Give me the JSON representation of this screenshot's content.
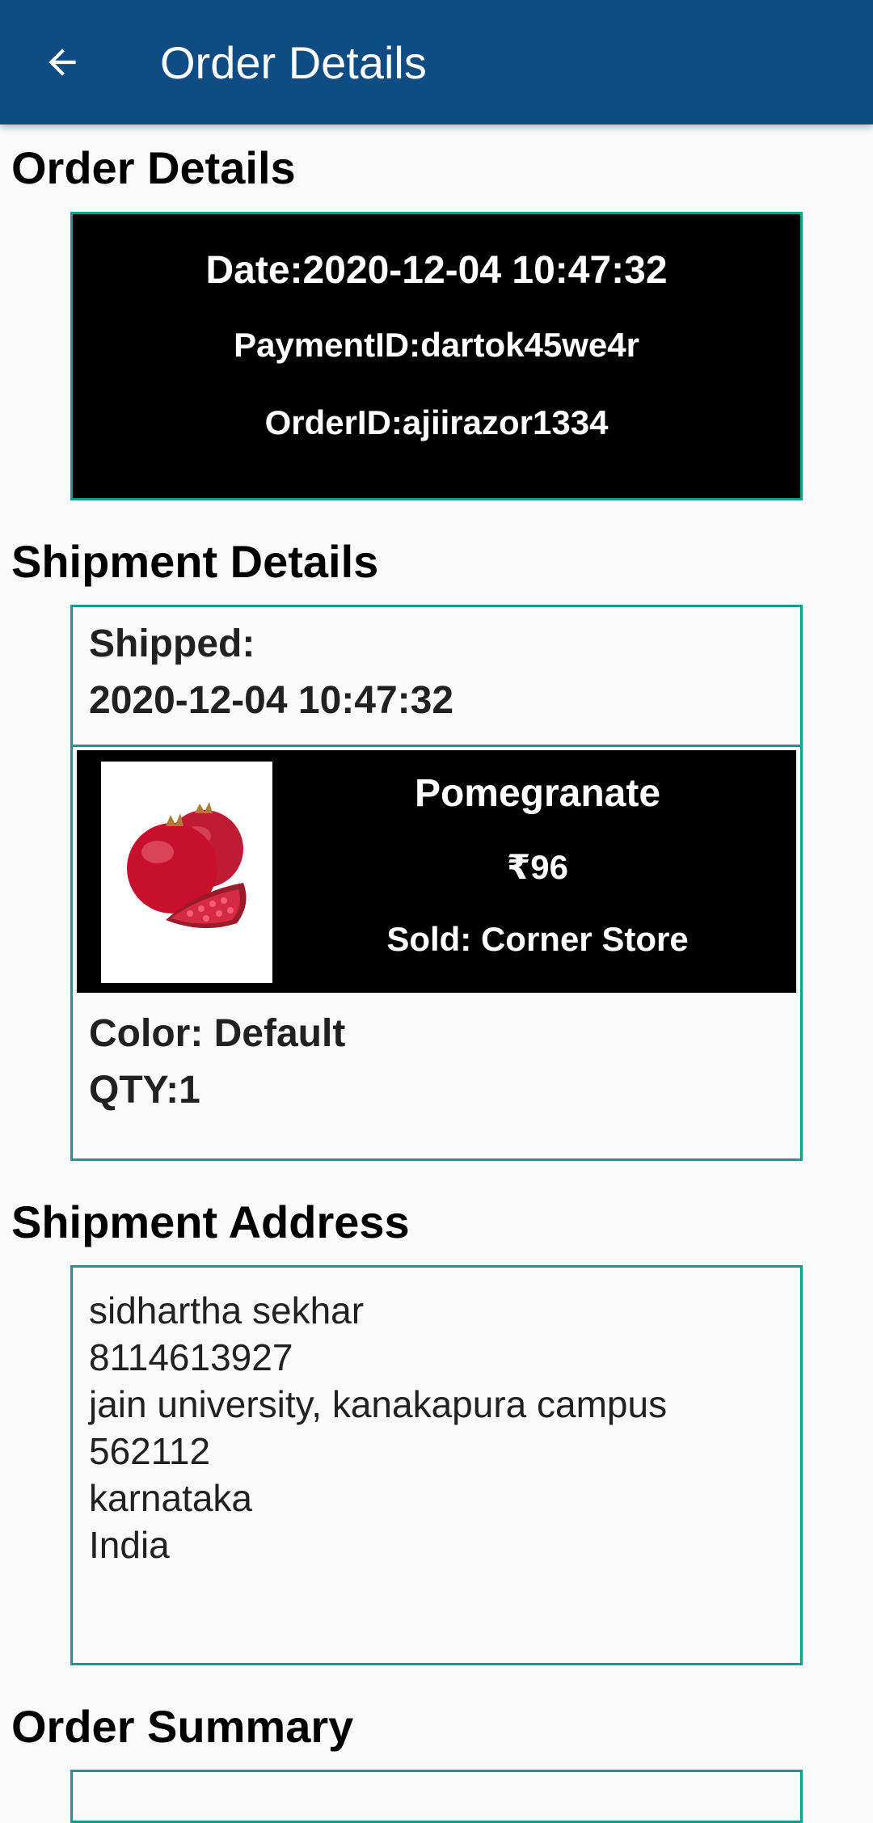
{
  "appbar": {
    "title": "Order Details",
    "back_icon": "arrow-left-icon"
  },
  "sections": {
    "order_details": "Order Details",
    "shipment_details": "Shipment Details",
    "shipment_address": "Shipment Address",
    "order_summary": "Order Summary"
  },
  "order": {
    "date_line": "Date:2020-12-04 10:47:32",
    "payment_line": "PaymentID:dartok45we4r",
    "orderid_line": "OrderID:ajiirazor1334"
  },
  "shipment": {
    "shipped_label": "Shipped:",
    "shipped_date": "2020-12-04 10:47:32",
    "product": {
      "name": "Pomegranate",
      "price": "₹96",
      "seller": "Sold: Corner Store",
      "image_icon": "pomegranate-image"
    },
    "color_line": "Color: Default",
    "qty_line": "QTY:1"
  },
  "address": {
    "name": "sidhartha sekhar",
    "phone": "8114613927",
    "street": "jain university, kanakapura campus",
    "pincode": "562112",
    "state": "karnataka",
    "country": "India"
  },
  "colors": {
    "appbar": "#0f4c84",
    "border_teal": "#1a9a8e",
    "card_black": "#000000"
  }
}
